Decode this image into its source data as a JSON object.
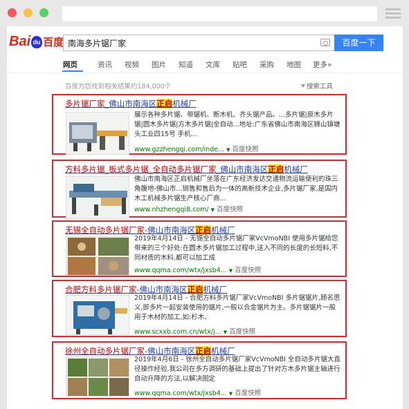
{
  "browser": {
    "url": ""
  },
  "header": {
    "logo": {
      "bai": "Bai",
      "paw": "du",
      "du": "百度"
    },
    "search_query": "南海多片锯厂家",
    "search_button": "百度一下"
  },
  "tabs": [
    {
      "label": "网页",
      "active": true
    },
    {
      "label": "资讯"
    },
    {
      "label": "视频"
    },
    {
      "label": "图片"
    },
    {
      "label": "知道"
    },
    {
      "label": "文库"
    },
    {
      "label": "贴吧"
    },
    {
      "label": "采购"
    },
    {
      "label": "地图"
    },
    {
      "label": "更多»"
    }
  ],
  "result_count": "百度为您找到相关结果约184,000个",
  "search_tools": "搜索工具",
  "results": [
    {
      "title_a": "多片锯厂家",
      "title_b": "_佛山市南海区",
      "title_c": "正启",
      "title_d": "机械厂",
      "body": [
        [
          "展示各种",
          "多片锯",
          "、带锯机、断木机、齐头锯产品。...",
          "多片锯",
          "|原木",
          "多片",
          "锯",
          "|圆木",
          "多片锯",
          "|方木",
          "多片锯",
          "|全自动...地址:广东省佛山市",
          "南海区",
          "狮山镇塘头工业四15号 手机..."
        ]
      ],
      "body_text": "展示各种多片锯、带锯机、断木机、齐头锯产品。...多片锯|原木多片锯|圆木多片锯|方木多片锯|全自动...地址:广东省佛山市南海区狮山镇塘头工业四15号 手机...",
      "url": "www.gzzhengqi.com/inde...",
      "snapshot": "百度快照"
    },
    {
      "title_a": "方料多片锯_板式多片锯_全自动多片锯厂家",
      "title_b": "_佛山市南海区",
      "title_c": "正启",
      "title_d": "机械厂",
      "body_text": "佛山市南海区正启机械厂坐落在广东经济发达交通物流运输便利的珠三角腹地-佛山市...销售和售后为一体的高新技术企业,多片锯厂家,是国内木工机械多片锯生产核心厂商...",
      "url": "www.nhzhengqi8.com/",
      "snapshot": "百度快照"
    },
    {
      "title_a": "无锡全自动多片锯厂家",
      "title_b": "-佛山市南海区",
      "title_c": "正启",
      "title_d": "机械厂",
      "body_text": "2019年4月14日 - 无锡全自动多片锯厂家VcVmoNBI 使用多片锯给您带来的三个好处:在圆木多片锯加工过程中,送入不同的长度的长短料,不同材质的木料,都可以加工成",
      "url": "www.qqma.com/wtx/jxsb4...",
      "snapshot": "百度快照"
    },
    {
      "title_a": "合肥方料多片锯厂家",
      "title_b": "-佛山市南海区",
      "title_c": "正启",
      "title_d": "机械厂",
      "body_text": "2019年4月14日 - 合肥方料多片锯厂家VcVmoNBI 多片锯锯片,顾名思义,即多片一起安装使用的锯片,一般以合金锯片为主。多片锯锯片一般用于木材的加工,如:杉木、",
      "url": "www.scxxb.com.cn/wtx/j...",
      "snapshot": "百度快照"
    },
    {
      "title_a": "徐州全自动多片锯厂家",
      "title_b": "-佛山市南海区",
      "title_c": "正启",
      "title_d": "机械厂",
      "body_text": "2019年4月6日 - 徐州全自动多片锯厂家VcVmoNBI 全自动多片锯大直径操作经验,我公司在多方调研的基础上提出了针对方木多片锯主轴进行自动升降的方法,以解决固定",
      "url": "www.qqma.com/wtx/jxsb4...",
      "snapshot": "百度快照"
    }
  ],
  "colors": {
    "accent": "#3385ff",
    "highlight_border": "#e8232a",
    "link": "#2440b3",
    "url_green": "#008000"
  }
}
